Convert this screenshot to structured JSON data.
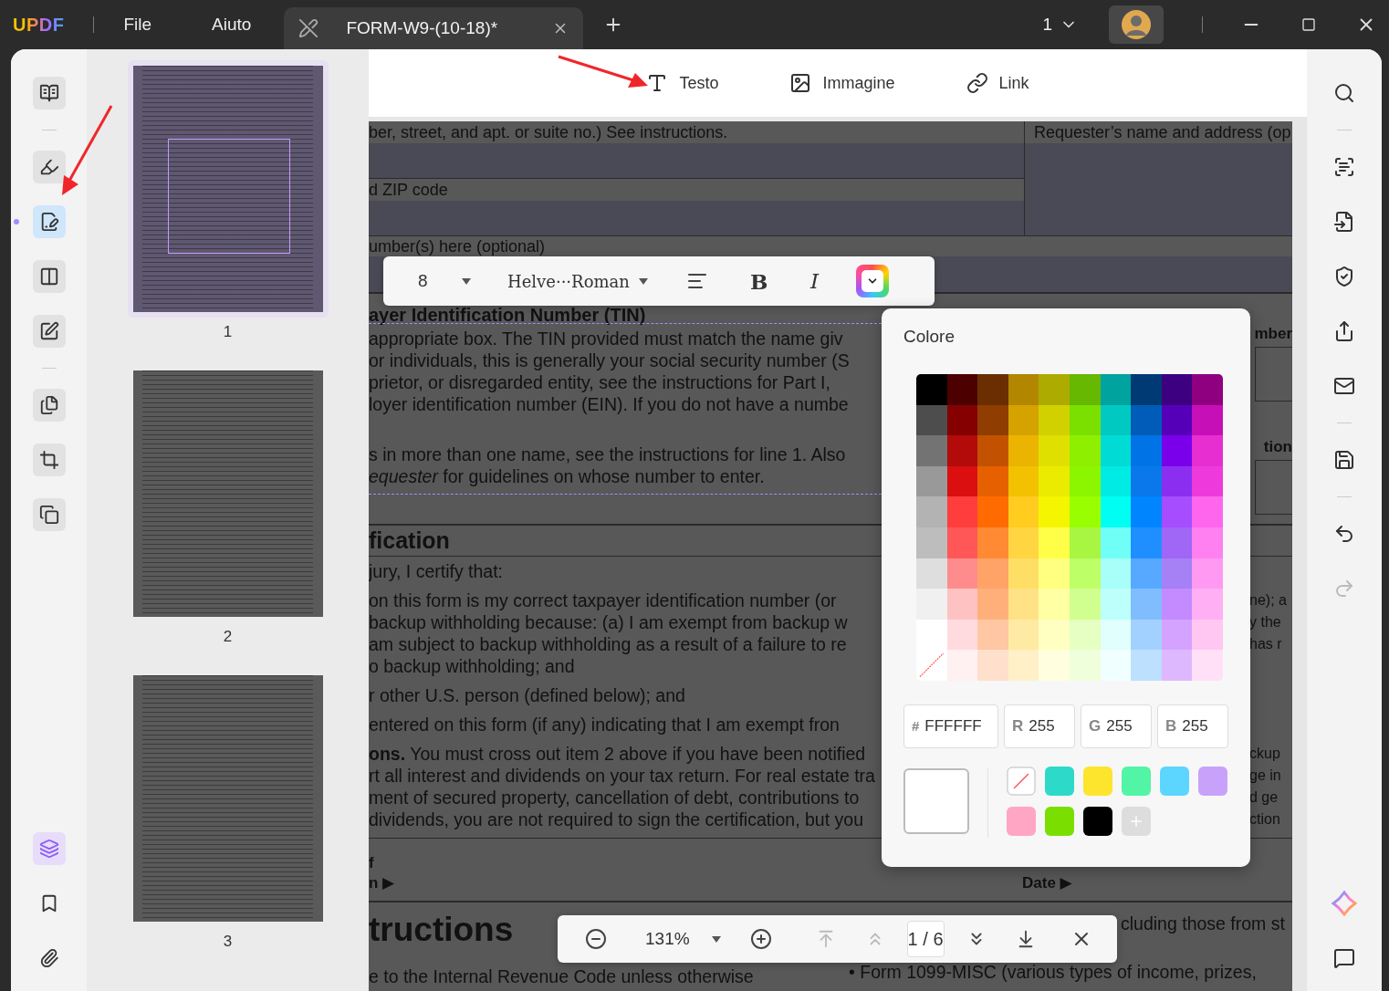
{
  "app": {
    "logo": "UPDF",
    "menu": [
      "File",
      "Aiuto"
    ]
  },
  "tabs": [
    {
      "title": "FORM-W9-(10-18)*",
      "selected": true
    }
  ],
  "window_controls": {
    "count": "1"
  },
  "left_rail": [
    {
      "selected": false
    },
    {
      "selected": false
    },
    {
      "selected": true
    },
    {
      "selected": false
    },
    {
      "selected": false
    },
    {
      "selected": false
    },
    {
      "selected": false
    },
    {
      "selected": false
    }
  ],
  "left_rail_bottom": [
    {
      "selected": true
    },
    {
      "selected": false
    },
    {
      "selected": false
    }
  ],
  "thumbnails": [
    {
      "page": "1",
      "selected": true
    },
    {
      "page": "2",
      "selected": false
    },
    {
      "page": "3",
      "selected": false
    }
  ],
  "edit_toolbar": [
    {
      "label": "Testo"
    },
    {
      "label": "Immagine"
    },
    {
      "label": "Link"
    }
  ],
  "format_toolbar": {
    "size": "8",
    "font": "Helve···Roman",
    "bold": "B",
    "italic": "I"
  },
  "document": {
    "form_fields": [
      "ber, street, and apt. or suite no.) See instructions.",
      "d ZIP code"
    ],
    "requester": "Requester’s name and address (op",
    "account_field": "umber(s) here (optional)",
    "tin_heading": "ayer Identification Number (TIN)",
    "tin_paragraphs": [
      [
        "appropriate box. The TIN provided must match the name giv",
        "or individuals, this is generally your social security number (S",
        "prietor, or disregarded entity, see the instructions for Part I,",
        "loyer identification number (EIN). If you do not have a numbe"
      ],
      [
        "s in more than one name, see the instructions for line 1. Also",
        "*equester* for guidelines on whose number to enter."
      ]
    ],
    "tin_right": [
      "mber",
      "tion"
    ],
    "cert_heading": "fication",
    "cert_paragraphs": [
      [
        {
          "left": "jury, I certify that:"
        }
      ],
      [
        {
          "left": "on this form is my correct taxpayer identification number (or",
          "right": "ne); a"
        },
        {
          "left": "backup withholding because: (a) I am exempt from backup w",
          "right": "y the"
        },
        {
          "left": "am subject to backup withholding as a result of a failure to re",
          "right": "has r"
        },
        {
          "left": "o backup withholding; and"
        }
      ],
      [
        {
          "left": "r other U.S. person (defined below); and"
        }
      ],
      [
        {
          "left": "entered on this form (if any) indicating that I am exempt fron"
        }
      ],
      [
        {
          "left": "**ons.** You must cross out item 2 above if you have been notified",
          "right": "ckup"
        },
        {
          "left": "rt all interest and dividends on your tax return. For real estate tra",
          "right": "ge in"
        },
        {
          "left": "ment of secured property, cancellation of debt, contributions to",
          "right": "d ge"
        },
        {
          "left": "dividends, you are not required to sign the certification, but you",
          "right": "ction"
        }
      ]
    ],
    "sign_labels": [
      "f",
      "n ▶"
    ],
    "date_label": "Date ▶",
    "instructions_heading": "tructions",
    "instructions_line": "e to the Internal Revenue Code unless otherwise",
    "instructions_right": [
      "cluding those from st",
      "• Form 1099-MISC (various types of income, prizes,"
    ]
  },
  "color_picker": {
    "title": "Colore",
    "palette": [
      [
        {
          "kind": "swatch",
          "color": "#000000"
        },
        {
          "kind": "swatch",
          "color": "#4d0000"
        },
        {
          "kind": "swatch",
          "color": "#6b2e00"
        },
        {
          "kind": "swatch",
          "color": "#b38600"
        },
        {
          "kind": "swatch",
          "color": "#adab00"
        },
        {
          "kind": "swatch",
          "color": "#66b800"
        },
        {
          "kind": "swatch",
          "color": "#00a39e"
        },
        {
          "kind": "swatch",
          "color": "#003a75"
        },
        {
          "kind": "swatch",
          "color": "#3d0080"
        },
        {
          "kind": "swatch",
          "color": "#8f0080"
        }
      ],
      [
        {
          "kind": "swatch",
          "color": "#4d4d4d"
        },
        {
          "kind": "swatch",
          "color": "#850000"
        },
        {
          "kind": "swatch",
          "color": "#8f3d00"
        },
        {
          "kind": "swatch",
          "color": "#d4a300"
        },
        {
          "kind": "swatch",
          "color": "#d1d100"
        },
        {
          "kind": "swatch",
          "color": "#7be000"
        },
        {
          "kind": "swatch",
          "color": "#00c9c2"
        },
        {
          "kind": "swatch",
          "color": "#005cb8"
        },
        {
          "kind": "swatch",
          "color": "#5500b8"
        },
        {
          "kind": "swatch",
          "color": "#c70fb8"
        }
      ],
      [
        {
          "kind": "swatch",
          "color": "#737373"
        },
        {
          "kind": "swatch",
          "color": "#b30a0a"
        },
        {
          "kind": "swatch",
          "color": "#c25200"
        },
        {
          "kind": "swatch",
          "color": "#ebb400"
        },
        {
          "kind": "swatch",
          "color": "#e0e000"
        },
        {
          "kind": "swatch",
          "color": "#8ef000"
        },
        {
          "kind": "swatch",
          "color": "#00dbd6"
        },
        {
          "kind": "swatch",
          "color": "#0073e6"
        },
        {
          "kind": "swatch",
          "color": "#7a00eb"
        },
        {
          "kind": "swatch",
          "color": "#e62ed1"
        }
      ],
      [
        {
          "kind": "swatch",
          "color": "#999999"
        },
        {
          "kind": "swatch",
          "color": "#db0f0f"
        },
        {
          "kind": "swatch",
          "color": "#e66000"
        },
        {
          "kind": "swatch",
          "color": "#f2c200"
        },
        {
          "kind": "swatch",
          "color": "#ebeb00"
        },
        {
          "kind": "swatch",
          "color": "#8cf500"
        },
        {
          "kind": "swatch",
          "color": "#00ebe3"
        },
        {
          "kind": "swatch",
          "color": "#0a78eb"
        },
        {
          "kind": "swatch",
          "color": "#8c2ef0"
        },
        {
          "kind": "swatch",
          "color": "#ee3add"
        }
      ],
      [
        {
          "kind": "swatch",
          "color": "#b3b3b3"
        },
        {
          "kind": "swatch",
          "color": "#ff3d3d"
        },
        {
          "kind": "swatch",
          "color": "#ff6b00"
        },
        {
          "kind": "swatch",
          "color": "#ffcc1f"
        },
        {
          "kind": "swatch",
          "color": "#f5f500"
        },
        {
          "kind": "swatch",
          "color": "#99ff00"
        },
        {
          "kind": "swatch",
          "color": "#00fff2"
        },
        {
          "kind": "swatch",
          "color": "#0085ff"
        },
        {
          "kind": "swatch",
          "color": "#a64dff"
        },
        {
          "kind": "swatch",
          "color": "#ff66ee"
        }
      ],
      [
        {
          "kind": "swatch",
          "color": "#bdbdbd"
        },
        {
          "kind": "swatch",
          "color": "#ff5757"
        },
        {
          "kind": "swatch",
          "color": "#ff8a33"
        },
        {
          "kind": "swatch",
          "color": "#ffd642"
        },
        {
          "kind": "swatch",
          "color": "#ffff47"
        },
        {
          "kind": "swatch",
          "color": "#a8f542"
        },
        {
          "kind": "swatch",
          "color": "#70fff7"
        },
        {
          "kind": "swatch",
          "color": "#1f8fff"
        },
        {
          "kind": "swatch",
          "color": "#a066f5"
        },
        {
          "kind": "swatch",
          "color": "#ff80f0"
        }
      ],
      [
        {
          "kind": "swatch",
          "color": "#dedede"
        },
        {
          "kind": "swatch",
          "color": "#ff8c8c"
        },
        {
          "kind": "swatch",
          "color": "#ffa366"
        },
        {
          "kind": "swatch",
          "color": "#ffde66"
        },
        {
          "kind": "swatch",
          "color": "#ffff80"
        },
        {
          "kind": "swatch",
          "color": "#bdff66"
        },
        {
          "kind": "swatch",
          "color": "#a8fff9"
        },
        {
          "kind": "swatch",
          "color": "#57a8ff"
        },
        {
          "kind": "swatch",
          "color": "#a680f5"
        },
        {
          "kind": "swatch",
          "color": "#ff99f2"
        }
      ],
      [
        {
          "kind": "swatch",
          "color": "#f0f0f0"
        },
        {
          "kind": "swatch",
          "color": "#ffc2c2"
        },
        {
          "kind": "swatch",
          "color": "#ffb07a"
        },
        {
          "kind": "swatch",
          "color": "#ffe285"
        },
        {
          "kind": "swatch",
          "color": "#ffffa3"
        },
        {
          "kind": "swatch",
          "color": "#d1ff8f"
        },
        {
          "kind": "swatch",
          "color": "#bdfffb"
        },
        {
          "kind": "swatch",
          "color": "#80bdff"
        },
        {
          "kind": "swatch",
          "color": "#c48aff"
        },
        {
          "kind": "swatch",
          "color": "#ffb0f5"
        }
      ],
      [
        {
          "kind": "swatch",
          "color": "#ffffff"
        },
        {
          "kind": "swatch",
          "color": "#ffdbe0"
        },
        {
          "kind": "swatch",
          "color": "#ffc7a3"
        },
        {
          "kind": "swatch",
          "color": "#ffeaa3"
        },
        {
          "kind": "swatch",
          "color": "#ffffc2"
        },
        {
          "kind": "swatch",
          "color": "#e6ffc2"
        },
        {
          "kind": "swatch",
          "color": "#e0fffd"
        },
        {
          "kind": "swatch",
          "color": "#a3d1ff"
        },
        {
          "kind": "swatch",
          "color": "#d4a3ff"
        },
        {
          "kind": "swatch",
          "color": "#ffc7f2"
        }
      ],
      [
        {
          "kind": "none"
        },
        {
          "kind": "swatch",
          "color": "#fff0f2"
        },
        {
          "kind": "swatch",
          "color": "#ffe0cc"
        },
        {
          "kind": "swatch",
          "color": "#fff0c7"
        },
        {
          "kind": "swatch",
          "color": "#ffffe0"
        },
        {
          "kind": "swatch",
          "color": "#f0ffdb"
        },
        {
          "kind": "swatch",
          "color": "#f0ffff"
        },
        {
          "kind": "swatch",
          "color": "#bde0ff"
        },
        {
          "kind": "swatch",
          "color": "#ddb8ff"
        },
        {
          "kind": "swatch",
          "color": "#ffe0f7"
        }
      ]
    ],
    "hex_prefix": "#",
    "hex": "FFFFFF",
    "channels": [
      {
        "label": "R",
        "value": "255"
      },
      {
        "label": "G",
        "value": "255"
      },
      {
        "label": "B",
        "value": "255"
      }
    ],
    "preview": {
      "color": "#ffffff"
    },
    "presets": [
      {
        "kind": "none"
      },
      {
        "kind": "swatch",
        "color": "#2ddac9"
      },
      {
        "kind": "swatch",
        "color": "#fde52d"
      },
      {
        "kind": "swatch",
        "color": "#52f5a5"
      },
      {
        "kind": "swatch",
        "color": "#5cd6ff"
      },
      {
        "kind": "swatch",
        "color": "#c8a2fa"
      },
      {
        "kind": "swatch",
        "color": "#ffa6c4"
      },
      {
        "kind": "swatch",
        "color": "#7adf00"
      },
      {
        "kind": "swatch",
        "color": "#000000"
      }
    ]
  },
  "zoom_bar": {
    "zoom": "131%",
    "page": "1 / 6",
    "nav": [
      {
        "disabled": true
      },
      {
        "disabled": true
      },
      {
        "disabled": false
      },
      {
        "disabled": false
      }
    ]
  },
  "right_rail": [
    {
      "disabled": false
    },
    {
      "disabled": false
    },
    {
      "disabled": false
    },
    {
      "disabled": false
    },
    {
      "disabled": false
    },
    {
      "disabled": false
    },
    {
      "disabled": false
    },
    {
      "disabled": false
    },
    {
      "disabled": true
    }
  ]
}
